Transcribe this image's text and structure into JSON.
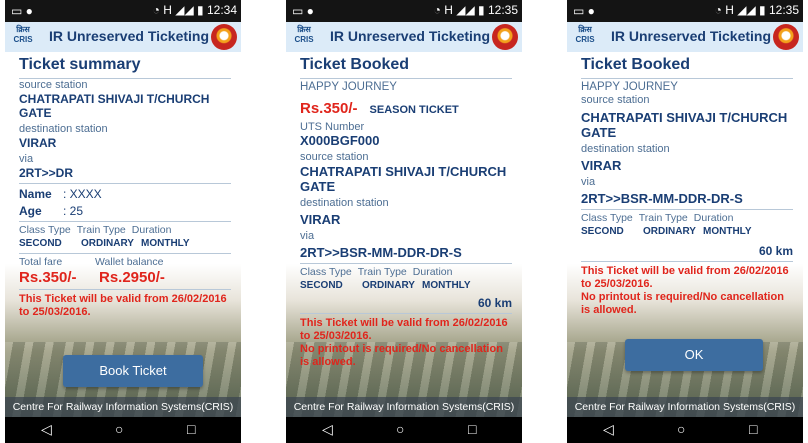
{
  "app": {
    "title": "IR Unreserved Ticketing",
    "footer": "Centre For Railway Information Systems(CRIS)",
    "logo_text": "क्रिस CRIS"
  },
  "status_bar": [
    {
      "time": "12:34",
      "network": "H"
    },
    {
      "time": "12:35",
      "network": "H"
    },
    {
      "time": "12:35",
      "network": "H"
    }
  ],
  "nav": {
    "back_icon": "◁",
    "home_icon": "○",
    "recent_icon": "□"
  },
  "screen1": {
    "heading": "Ticket summary",
    "source_label": "source station",
    "source_value": "CHATRAPATI SHIVAJI T/CHURCH GATE",
    "dest_label": "destination station",
    "dest_value": "VIRAR",
    "via_label": "via",
    "via_value": "2RT>>DR",
    "name_label": "Name",
    "name_value": ": XXXX",
    "age_label": "Age",
    "age_value": ": 25",
    "class_label": "Class Type",
    "train_label": "Train Type",
    "duration_label": "Duration",
    "class_value": "SECOND",
    "train_value": "ORDINARY",
    "duration_value": "MONTHLY",
    "fare_label": "Total fare",
    "wallet_label": "Wallet balance",
    "fare_value": "Rs.350/-",
    "wallet_value": "Rs.2950/-",
    "validity": "This Ticket will be valid from 26/02/2016 to 25/03/2016.",
    "button": "Book Ticket"
  },
  "screen2": {
    "heading": "Ticket Booked",
    "journey": "HAPPY JOURNEY",
    "fare": "Rs.350/-",
    "ticket_type": "SEASON TICKET",
    "uts_label": "UTS Number",
    "uts_value": "X000BGF000",
    "source_label": "source station",
    "source_value": "CHATRAPATI SHIVAJI T/CHURCH GATE",
    "dest_label": "destination station",
    "dest_value": "VIRAR",
    "via_label": "via",
    "via_value": "2RT>>BSR-MM-DDR-DR-S",
    "class_label": "Class Type",
    "train_label": "Train Type",
    "duration_label": "Duration",
    "class_value": "SECOND",
    "train_value": "ORDINARY",
    "duration_value": "MONTHLY",
    "distance": "60 km",
    "validity": "This Ticket will be valid from 26/02/2016 to 25/03/2016.",
    "notice": "No printout is required/No cancellation is allowed."
  },
  "screen3": {
    "heading": "Ticket Booked",
    "journey": "HAPPY JOURNEY",
    "source_label": "source station",
    "source_value": "CHATRAPATI SHIVAJI T/CHURCH GATE",
    "dest_label": "destination station",
    "dest_value": "VIRAR",
    "via_label": "via",
    "via_value": "2RT>>BSR-MM-DDR-DR-S",
    "class_label": "Class Type",
    "train_label": "Train Type",
    "duration_label": "Duration",
    "class_value": "SECOND",
    "train_value": "ORDINARY",
    "duration_value": "MONTHLY",
    "distance": "60 km",
    "validity": "This Ticket will be valid from 26/02/2016 to 25/03/2016.",
    "notice": "No printout is required/No cancellation is allowed.",
    "button": "OK"
  }
}
